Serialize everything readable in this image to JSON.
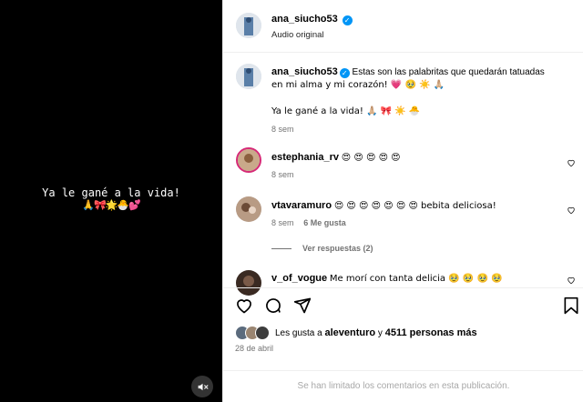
{
  "video": {
    "caption": "Ya le gané a la vida!",
    "caption_emoji": "🙏🎀🌟🐣💕"
  },
  "header": {
    "username": "ana_siucho53",
    "audio": "Audio original"
  },
  "caption_post": {
    "username": "ana_siucho53",
    "text_line1": "Estas son las palabritas que quedarán tatuadas",
    "text_line2": "en mi alma y mi corazón! 💗 🥹 ☀️ 🙏🏼",
    "text_line3": "Ya le gané a la vida! 🙏🏼 🎀 ☀️ 🐣",
    "time": "8 sem"
  },
  "comments": [
    {
      "username": "estephania_rv",
      "text": "😍 😍 😍 😍 😍",
      "time": "8 sem",
      "likes": ""
    },
    {
      "username": "vtavaramuro",
      "text": "😍 😍 😍 😍 😍 😍 😍 bebita deliciosa!",
      "time": "8 sem",
      "likes": "6 Me gusta"
    },
    {
      "username": "v_of_vogue",
      "text": "Me morí con tanta delicia 🥹 🥹 🥹 🥹",
      "time": "",
      "likes": ""
    }
  ],
  "view_replies": "Ver respuestas (2)",
  "likes": {
    "prefix": "Les gusta a",
    "user": "aleventuro",
    "conj": "y",
    "others": "4511 personas más"
  },
  "date": "28 de abril",
  "footer_note": "Se han limitado los comentarios en esta publicación.",
  "icons": {
    "verified": "verified-badge-icon",
    "mute": "speaker-muted-icon",
    "like": "heart-icon",
    "comment": "comment-bubble-icon",
    "share": "paper-plane-icon",
    "save": "bookmark-icon"
  },
  "colors": {
    "verified_blue": "#0095f6",
    "secondary_text": "#737373",
    "story_ring": "#d62976"
  }
}
